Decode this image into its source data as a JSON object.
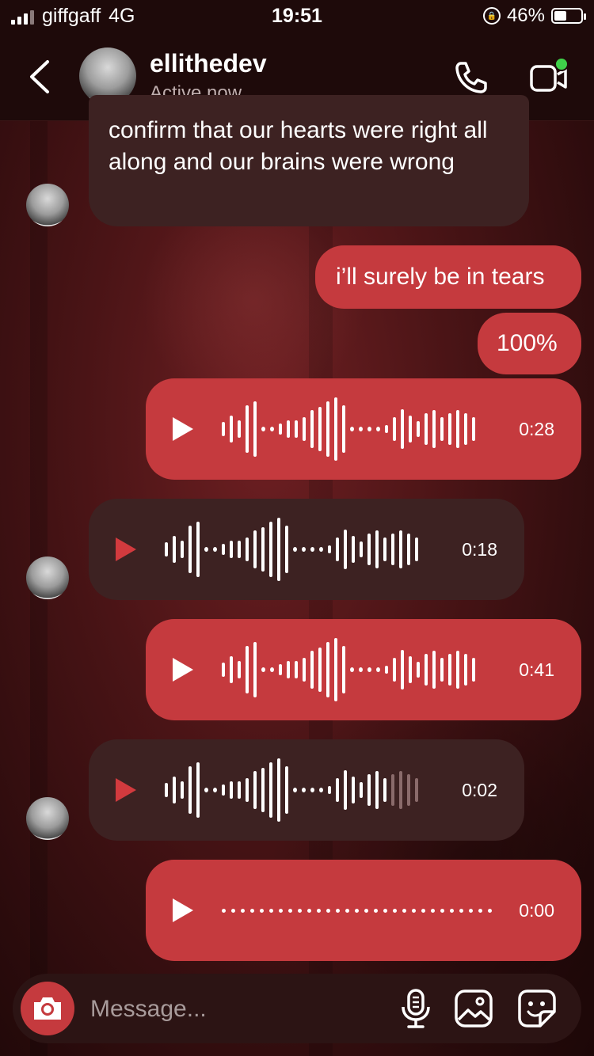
{
  "status_bar": {
    "carrier": "giffgaff",
    "network": "4G",
    "time": "19:51",
    "battery": "46%",
    "battery_level": 0.46
  },
  "header": {
    "username": "ellithedev",
    "status": "Active now"
  },
  "messages": {
    "m1": "confirm that our hearts were right all along and our brains were wrong",
    "m2": "i’ll surely be in tears",
    "m3": "100%",
    "v1": "0:28",
    "v2": "0:18",
    "v3": "0:41",
    "v4": "0:02",
    "v5": "0:00"
  },
  "composer": {
    "placeholder": "Message..."
  },
  "colors": {
    "outgoing": "#c53a3e",
    "incoming": "#3d2222",
    "active_dot": "#3fd14a"
  },
  "icons": [
    "back-chevron-icon",
    "phone-icon",
    "video-icon",
    "camera-icon",
    "microphone-icon",
    "image-icon",
    "sticker-icon",
    "play-icon"
  ]
}
